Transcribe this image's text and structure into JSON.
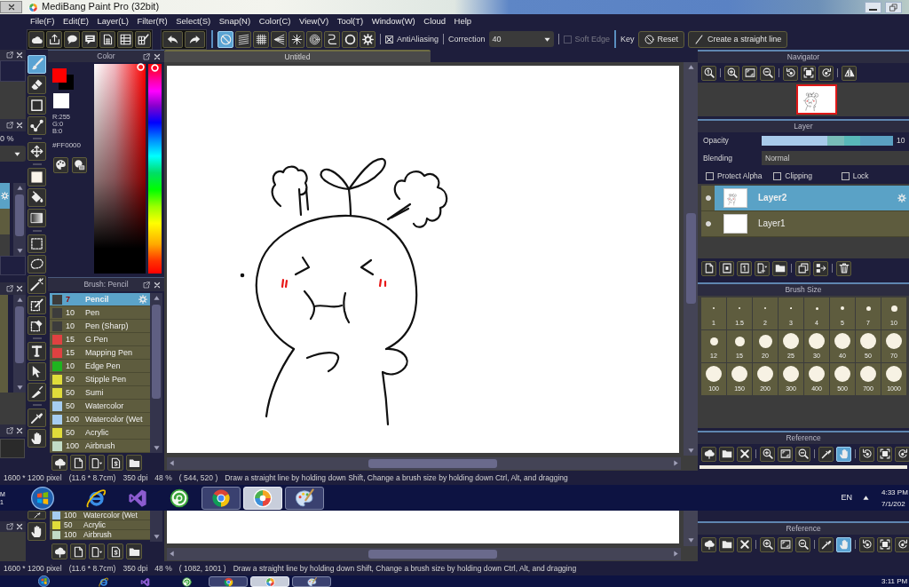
{
  "window": {
    "title": "MediBang Paint Pro (32bit)"
  },
  "menu": [
    "File(F)",
    "Edit(E)",
    "Layer(L)",
    "Filter(R)",
    "Select(S)",
    "Snap(N)",
    "Color(C)",
    "View(V)",
    "Tool(T)",
    "Window(W)",
    "Cloud",
    "Help"
  ],
  "snap_buttons": [
    {
      "selected": true
    },
    {
      "selected": false
    },
    {
      "selected": false
    },
    {
      "selected": false
    },
    {
      "selected": false
    },
    {
      "selected": false
    },
    {
      "selected": false
    },
    {
      "selected": false
    },
    {
      "selected": false
    }
  ],
  "brush_options": {
    "antialiasing": {
      "label": "AntiAliasing",
      "checked": true
    },
    "correction": {
      "label": "Correction",
      "value": "40"
    },
    "soft_edge": {
      "label": "Soft Edge",
      "checked": false,
      "disabled": true
    },
    "key_label": "Key",
    "buttons": [
      "Reset",
      "Create a straight line"
    ]
  },
  "left_edge": {
    "zoom_text": "0 %",
    "rows": [
      {
        "selected": true
      },
      {
        "selected": false
      }
    ]
  },
  "tools": [
    {
      "selected": true
    },
    {
      "selected": false
    },
    {
      "selected": false
    },
    {
      "selected": false
    },
    {
      "selected": false
    },
    {
      "selected": false
    },
    {
      "selected": false
    },
    {
      "selected": false
    },
    {
      "selected": false
    },
    {
      "selected": false
    },
    {
      "selected": false
    },
    {
      "selected": false
    },
    {
      "selected": false
    },
    {
      "selected": false
    },
    {
      "selected": false
    },
    {
      "selected": false
    },
    {
      "selected": false
    },
    {
      "selected": false
    }
  ],
  "color_panel": {
    "title": "Color",
    "swatches": [
      {
        "color": "#ff0000"
      },
      {
        "color": "#000000"
      },
      {
        "color": "#ffffff"
      }
    ],
    "rgb": [
      "R:255",
      "G:0",
      "B:0"
    ],
    "hex": "#FF0000",
    "hue": {
      "level": 0
    }
  },
  "brush_panel": {
    "title": "Brush: Pencil",
    "brushes": [
      {
        "size": "7",
        "name": "Pencil",
        "color": "#3c3c3c",
        "selected": true
      },
      {
        "size": "10",
        "name": "Pen",
        "color": "#3c3c3c",
        "selected": false
      },
      {
        "size": "10",
        "name": "Pen (Sharp)",
        "color": "#3c3c3c",
        "selected": false
      },
      {
        "size": "15",
        "name": "G Pen",
        "color": "#e04141",
        "selected": false
      },
      {
        "size": "15",
        "name": "Mapping Pen",
        "color": "#e04141",
        "selected": false
      },
      {
        "size": "10",
        "name": "Edge Pen",
        "color": "#1fb41f",
        "selected": false
      },
      {
        "size": "50",
        "name": "Stipple Pen",
        "color": "#e0dc3a",
        "selected": false
      },
      {
        "size": "50",
        "name": "Sumi",
        "color": "#e0dc3a",
        "selected": false
      },
      {
        "size": "50",
        "name": "Watercolor",
        "color": "#a6cdf0",
        "selected": false
      },
      {
        "size": "100",
        "name": "Watercolor (Wet",
        "color": "#a6cdf0",
        "selected": false
      },
      {
        "size": "50",
        "name": "Acrylic",
        "color": "#e0dc3a",
        "selected": false
      },
      {
        "size": "100",
        "name": "Airbrush",
        "color": "#c2dcc6",
        "selected": false
      }
    ]
  },
  "canvas": {
    "tab": "Untitled"
  },
  "navigator": {
    "title": "Navigator"
  },
  "layer_panel": {
    "title": "Layer",
    "opacity": {
      "label": "Opacity",
      "level": 1,
      "value": "10"
    },
    "blending": {
      "label": "Blending",
      "value": "Normal"
    },
    "options": [
      {
        "label": "Protect Alpha",
        "checked": false
      },
      {
        "label": "Clipping",
        "checked": false
      },
      {
        "label": "Lock",
        "checked": false
      }
    ],
    "layers": [
      {
        "name": "Layer2",
        "selected": true,
        "visible": true
      },
      {
        "name": "Layer1",
        "selected": false,
        "visible": true
      }
    ]
  },
  "brush_size": {
    "title": "Brush Size",
    "sizes": [
      "1",
      "1.5",
      "2",
      "3",
      "4",
      "5",
      "7",
      "10",
      "12",
      "15",
      "20",
      "25",
      "30",
      "40",
      "50",
      "70",
      "100",
      "150",
      "200",
      "300",
      "400",
      "500",
      "700",
      "1000"
    ]
  },
  "reference": {
    "title": "Reference",
    "tools": [
      {
        "selected": false
      },
      {
        "selected": false
      },
      {
        "selected": false
      },
      {
        "selected": false
      },
      {
        "selected": false
      },
      {
        "selected": false
      },
      {
        "selected": false
      },
      {
        "selected": true
      },
      {
        "selected": false
      },
      {
        "selected": false
      },
      {
        "selected": false
      }
    ]
  },
  "status_bar": {
    "size": "1600 * 1200 pixel",
    "physical": "(11.6 * 8.7cm)",
    "dpi": "350 dpi",
    "zoom": "48 %",
    "cursor": "( 544, 520 )",
    "hint": "Draw a straight line by holding down Shift, Change a brush size by holding down Ctrl, Alt, and dragging"
  },
  "taskbar": {
    "edge_texts": [
      "M",
      "1"
    ],
    "apps": [
      {
        "running": false,
        "selected": false
      },
      {
        "running": false,
        "selected": false
      },
      {
        "running": false,
        "selected": false
      },
      {
        "running": true,
        "selected": false
      },
      {
        "running": true,
        "selected": true
      },
      {
        "running": true,
        "selected": false
      }
    ],
    "language": "EN",
    "time": "4:33 PM",
    "date": "7/1/202"
  },
  "lower_capture": {
    "tools": [
      {
        "selected": false
      },
      {
        "selected": false
      }
    ],
    "brushes": [
      {
        "size": "100",
        "name": "Watercolor (Wet",
        "color": "#a6cdf0",
        "selected": false
      },
      {
        "size": "50",
        "name": "Acrylic",
        "color": "#e0dc3a",
        "selected": false
      },
      {
        "size": "100",
        "name": "Airbrush",
        "color": "#c2dcc6",
        "selected": false
      }
    ],
    "reference": {
      "title": "Reference",
      "tools": [
        {
          "selected": false
        },
        {
          "selected": false
        },
        {
          "selected": false
        },
        {
          "selected": false
        },
        {
          "selected": false
        },
        {
          "selected": false
        },
        {
          "selected": false
        },
        {
          "selected": true
        },
        {
          "selected": false
        },
        {
          "selected": false
        },
        {
          "selected": false
        }
      ]
    },
    "status_bar": {
      "size": "1600 * 1200 pixel",
      "physical": "(11.6 * 8.7cm)",
      "dpi": "350 dpi",
      "zoom": "48 %",
      "cursor": "( 1082, 1001 )",
      "hint": "Draw a straight line by holding down Shift, Change a brush size by holding down Ctrl, Alt, and dragging"
    },
    "taskbar": {
      "apps": [
        {
          "running": false,
          "selected": false
        },
        {
          "running": false,
          "selected": false
        },
        {
          "running": false,
          "selected": false
        },
        {
          "running": true,
          "selected": false
        },
        {
          "running": true,
          "selected": true
        },
        {
          "running": true,
          "selected": false
        }
      ],
      "time": "3:11 PM"
    }
  }
}
